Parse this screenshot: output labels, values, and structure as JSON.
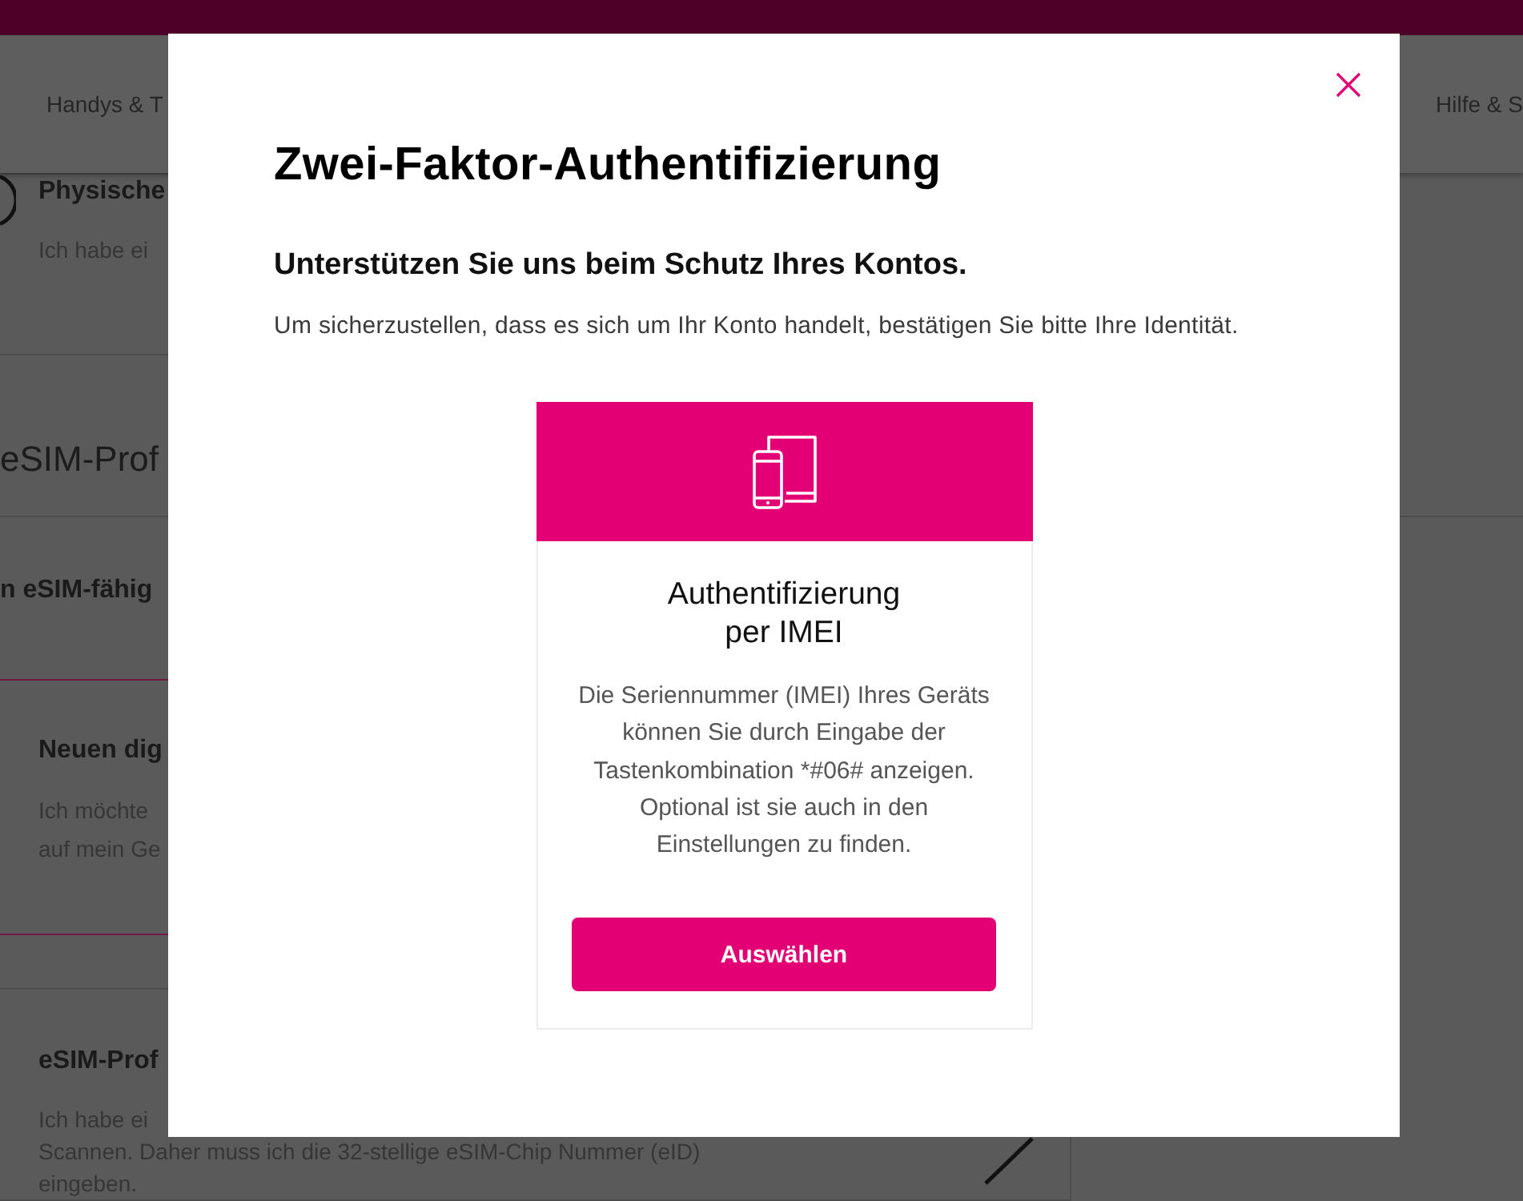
{
  "nav": {
    "items": [
      {
        "label": "Handys & T"
      },
      {
        "label": "Hilfe & S"
      }
    ]
  },
  "background_page": {
    "sections": [
      {
        "kind": "radio",
        "selected": false,
        "title": "Physische",
        "lines": [
          "Ich habe ei"
        ]
      },
      {
        "kind": "heading",
        "title": "eSIM-Prof"
      },
      {
        "kind": "label",
        "title": "n eSIM-fähig"
      },
      {
        "kind": "entry",
        "selected": true,
        "title": "Neuen dig",
        "lines": [
          "Ich möchte",
          "auf mein Ge"
        ]
      },
      {
        "kind": "action",
        "selected": false,
        "title": "eSIM-Prof",
        "lines": [
          "Ich habe ei",
          "Scannen. Daher muss ich die 32-stellige eSIM-Chip Nummer (eID)",
          "eingeben."
        ]
      }
    ]
  },
  "dialog": {
    "title": "Zwei-Faktor-Authentifizierung",
    "subtitle": "Unterstützen Sie uns beim Schutz Ihres Kontos.",
    "description": "Um sicherzustellen, dass es sich um Ihr Konto handelt, bestätigen Sie bitte Ihre Identität.",
    "options": [
      {
        "title": "Authentifizierung per IMEI",
        "description": "Die Seriennummer (IMEI) Ihres Geräts können Sie durch Eingabe der Tastenkombination *#06# anzeigen. Optional ist sie auch in den Einstellungen zu finden.",
        "button": "Auswählen"
      }
    ]
  }
}
